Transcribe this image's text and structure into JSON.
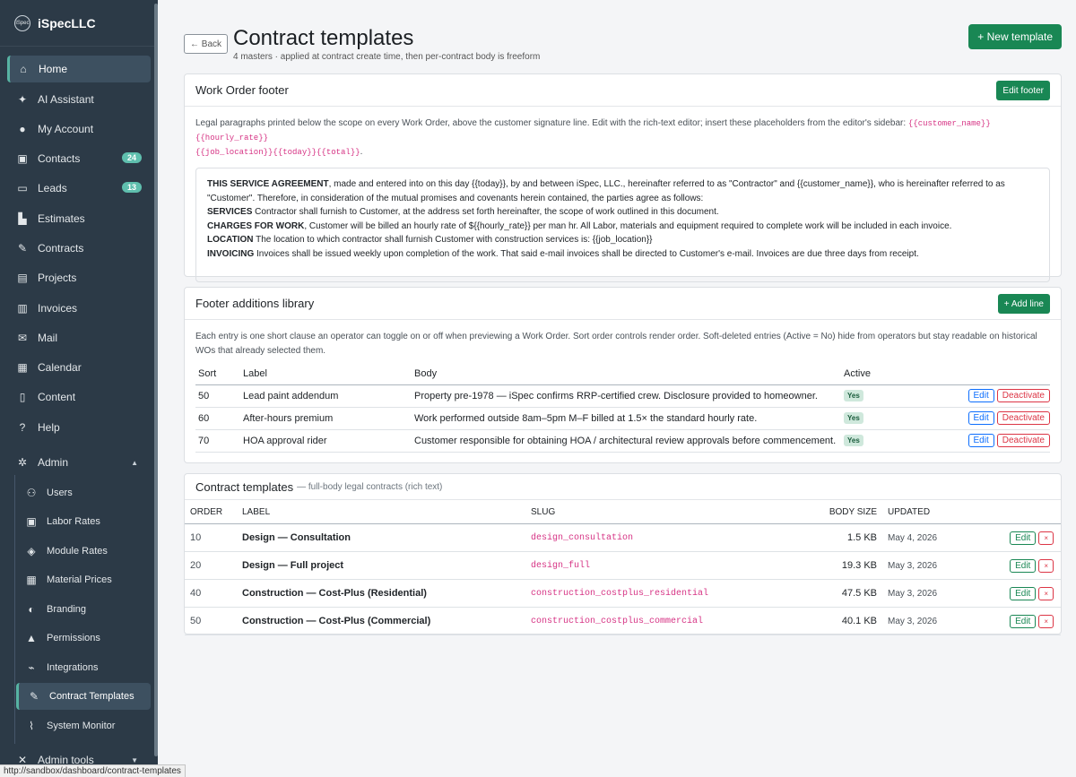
{
  "sidebar": {
    "brand_logo": "iSpec",
    "brand_name": "iSpecLLC",
    "items": [
      {
        "label": "Home",
        "icon": "home-icon",
        "glyph": "⌂"
      },
      {
        "label": "AI Assistant",
        "icon": "chat-icon",
        "glyph": "✦"
      },
      {
        "label": "My Account",
        "icon": "user-icon",
        "glyph": "●"
      },
      {
        "label": "Contacts",
        "icon": "contacts-icon",
        "glyph": "▣",
        "badge": "24"
      },
      {
        "label": "Leads",
        "icon": "inbox-icon",
        "glyph": "▭",
        "badge": "13"
      },
      {
        "label": "Estimates",
        "icon": "chart-icon",
        "glyph": "▙"
      },
      {
        "label": "Contracts",
        "icon": "file-signature-icon",
        "glyph": "✎"
      },
      {
        "label": "Projects",
        "icon": "clipboard-icon",
        "glyph": "▤"
      },
      {
        "label": "Invoices",
        "icon": "invoice-icon",
        "glyph": "▥"
      },
      {
        "label": "Mail",
        "icon": "mail-icon",
        "glyph": "✉"
      },
      {
        "label": "Calendar",
        "icon": "calendar-icon",
        "glyph": "▦"
      },
      {
        "label": "Content",
        "icon": "file-icon",
        "glyph": "▯"
      },
      {
        "label": "Help",
        "icon": "help-icon",
        "glyph": "?"
      },
      {
        "label": "Admin",
        "icon": "cog-icon",
        "glyph": "✲"
      }
    ],
    "admin_sub": [
      {
        "label": "Users",
        "icon": "users-icon",
        "glyph": "⚇"
      },
      {
        "label": "Labor Rates",
        "icon": "money-icon",
        "glyph": "▣"
      },
      {
        "label": "Module Rates",
        "icon": "cubes-icon",
        "glyph": "◈"
      },
      {
        "label": "Material Prices",
        "icon": "boxes-icon",
        "glyph": "▦"
      },
      {
        "label": "Branding",
        "icon": "palette-icon",
        "glyph": "◐"
      },
      {
        "label": "Permissions",
        "icon": "lock-icon",
        "glyph": "▲"
      },
      {
        "label": "Integrations",
        "icon": "plug-icon",
        "glyph": "⌁"
      },
      {
        "label": "Contract Templates",
        "icon": "file-signature-icon",
        "glyph": "✎"
      },
      {
        "label": "System Monitor",
        "icon": "chart-line-icon",
        "glyph": "⌇"
      }
    ],
    "admin_tools": {
      "label": "Admin tools",
      "icon": "tools-icon",
      "glyph": "✕"
    }
  },
  "statusbar": "http://sandbox/dashboard/contract-templates",
  "header": {
    "back": "← Back",
    "title": "Contract templates",
    "subtitle": "4 masters · applied at contract create time, then per-contract body is freeform",
    "new_button": "+ New template"
  },
  "footer_card": {
    "title": "Work Order footer",
    "button": "Edit footer",
    "desc": "Legal paragraphs printed below the scope on every Work Order, above the customer signature line. Edit with the rich-text editor; insert these placeholders from the editor's sidebar: ",
    "placeholders_1": "{{customer_name}}{{hourly_rate}}",
    "placeholders_2": "{{job_location}}{{today}}{{total}}",
    "desc_end": ".",
    "legal": {
      "p1_bold": "THIS SERVICE AGREEMENT",
      "p1": ", made and entered into on this day {{today}}, by and between iSpec, LLC., hereinafter referred to as \"Contractor\" and {{customer_name}}, who is hereinafter referred to as \"Customer\". Therefore, in consideration of the mutual promises and covenants herein contained, the parties agree as follows:",
      "p2_bold": "SERVICES",
      "p2": " Contractor shall furnish to Customer, at the address set forth hereinafter, the scope of work outlined in this document.",
      "p3_bold": "CHARGES FOR WORK",
      "p3": ", Customer will be billed an hourly rate of ${{hourly_rate}} per man hr. All Labor, materials and equipment required to complete work will be included in each invoice.",
      "p4_bold": "LOCATION",
      "p4": " The location to which contractor shall furnish Customer with construction services is: {{job_location}}",
      "p5_bold": "INVOICING",
      "p5": " Invoices shall be issued weekly upon completion of the work. That said e-mail invoices shall be directed to Customer's e-mail. Invoices are due three days from receipt."
    }
  },
  "library_card": {
    "title": "Footer additions library",
    "button": "+ Add line",
    "desc": "Each entry is one short clause an operator can toggle on or off when previewing a Work Order. Sort order controls render order. Soft-deleted entries (Active = No) hide from operators but stay readable on historical WOs that already selected them.",
    "columns": {
      "sort": "Sort",
      "label": "Label",
      "body": "Body",
      "active": "Active"
    },
    "rows": [
      {
        "sort": "50",
        "label": "Lead paint addendum",
        "body": "Property pre-1978 — iSpec confirms RRP-certified crew. Disclosure provided to homeowner.",
        "active": "Yes",
        "edit": "Edit",
        "deactivate": "Deactivate"
      },
      {
        "sort": "60",
        "label": "After-hours premium",
        "body": "Work performed outside 8am–5pm M–F billed at 1.5× the standard hourly rate.",
        "active": "Yes",
        "edit": "Edit",
        "deactivate": "Deactivate"
      },
      {
        "sort": "70",
        "label": "HOA approval rider",
        "body": "Customer responsible for obtaining HOA / architectural review approvals before commencement.",
        "active": "Yes",
        "edit": "Edit",
        "deactivate": "Deactivate"
      }
    ]
  },
  "templates_card": {
    "title": "Contract templates",
    "title_muted": "— full-body legal contracts (rich text)",
    "columns": {
      "order": "ORDER",
      "label": "LABEL",
      "slug": "SLUG",
      "size": "BODY SIZE",
      "updated": "UPDATED"
    },
    "rows": [
      {
        "order": "10",
        "label": "Design — Consultation",
        "slug": "design_consultation",
        "size": "1.5 KB",
        "updated": "May 4, 2026",
        "edit": "Edit",
        "delete": "×"
      },
      {
        "order": "20",
        "label": "Design — Full project",
        "slug": "design_full",
        "size": "19.3 KB",
        "updated": "May 3, 2026",
        "edit": "Edit",
        "delete": "×"
      },
      {
        "order": "40",
        "label": "Construction — Cost-Plus (Residential)",
        "slug": "construction_costplus_residential",
        "size": "47.5 KB",
        "updated": "May 3, 2026",
        "edit": "Edit",
        "delete": "×"
      },
      {
        "order": "50",
        "label": "Construction — Cost-Plus (Commercial)",
        "slug": "construction_costplus_commercial",
        "size": "40.1 KB",
        "updated": "May 3, 2026",
        "edit": "Edit",
        "delete": "×"
      }
    ]
  }
}
